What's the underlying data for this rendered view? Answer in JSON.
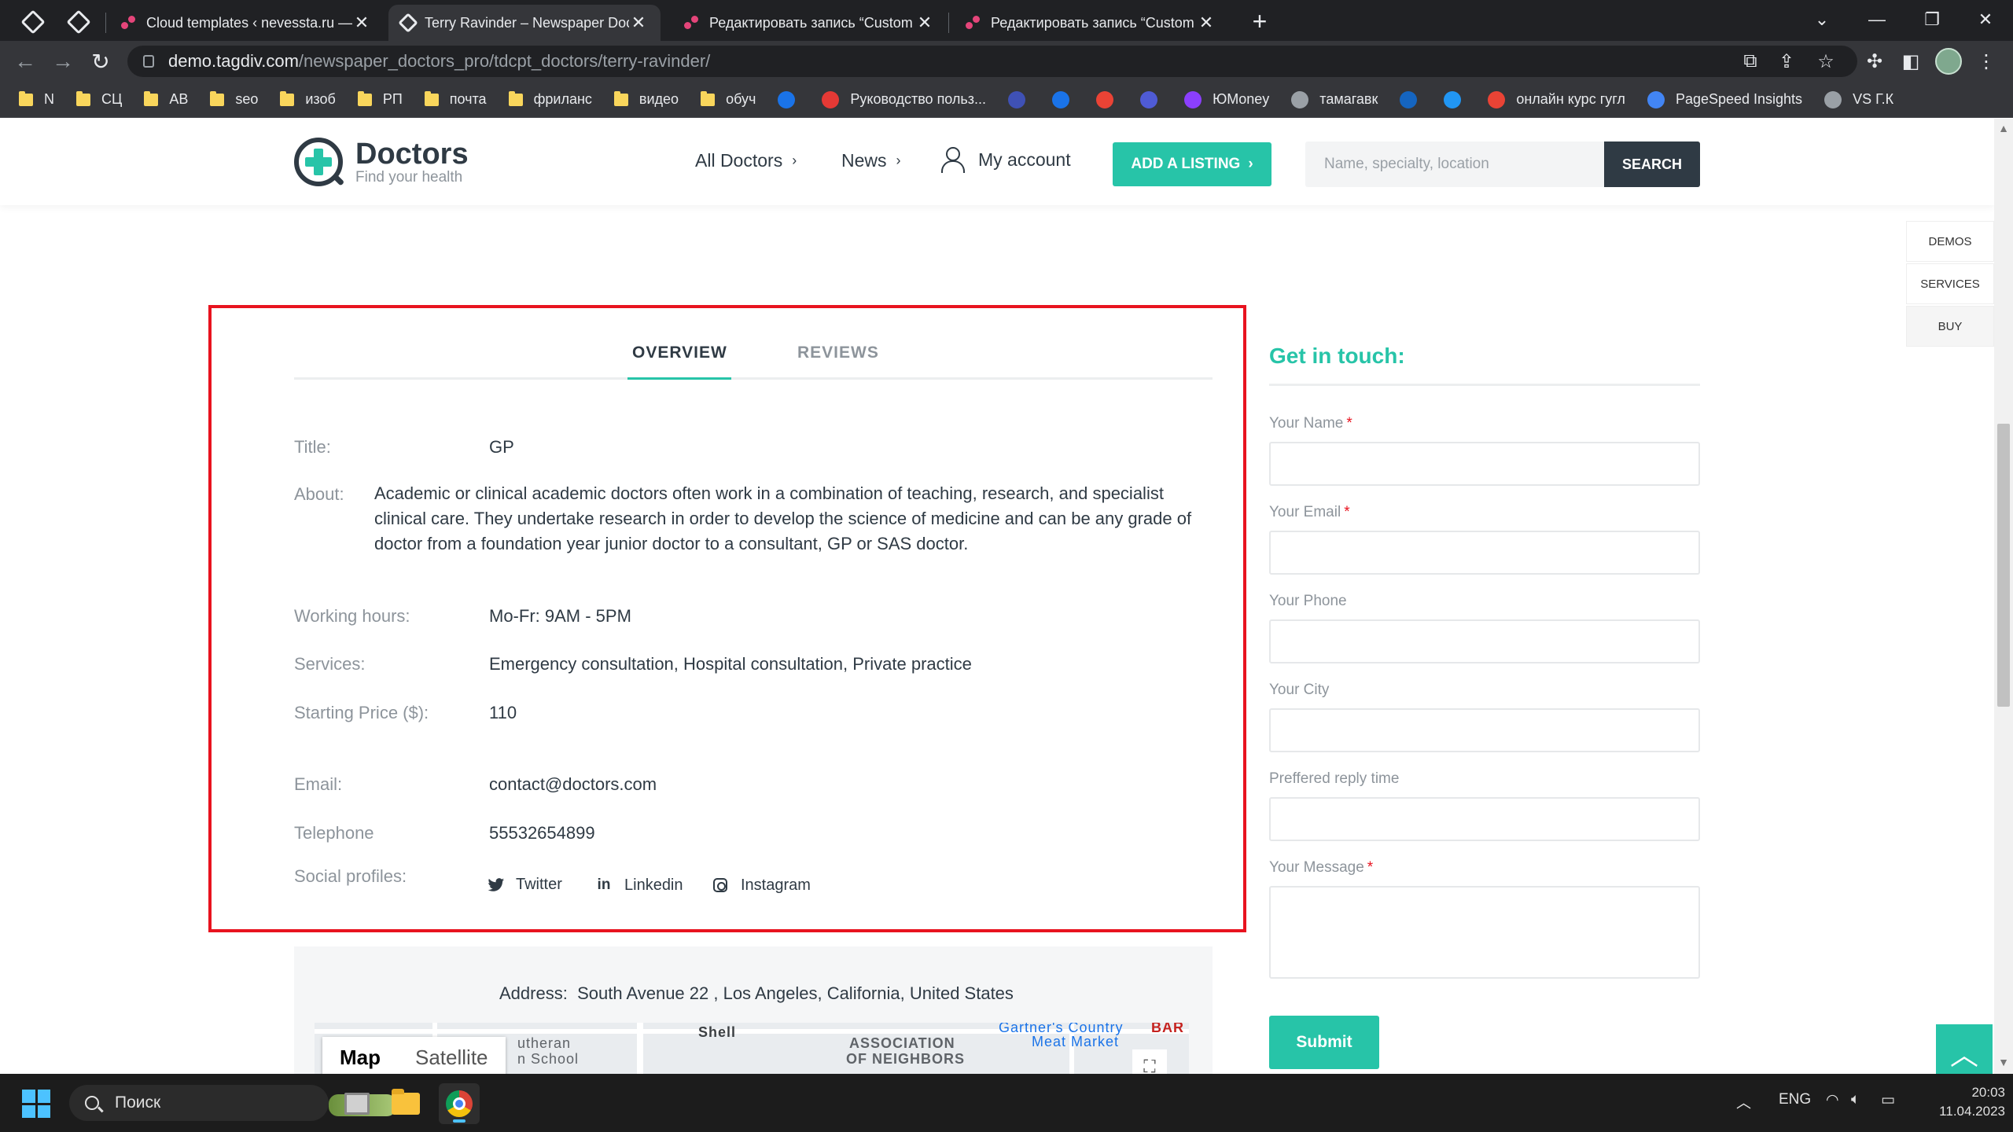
{
  "browser": {
    "tabs": [
      {
        "title": "Cloud templates ‹ nevessta.ru —",
        "active": false
      },
      {
        "title": "Terry Ravinder – Newspaper Doct",
        "active": true
      },
      {
        "title": "Редактировать запись “Custom",
        "active": false
      },
      {
        "title": "Редактировать запись “Custom",
        "active": false
      }
    ],
    "new_tab": "+",
    "tab_close": "✕",
    "url_host": "demo.tagdiv.com",
    "url_path": "/newspaper_doctors_pro/tdcpt_doctors/terry-ravinder/",
    "bookmarks": [
      {
        "label": "N",
        "type": "folder"
      },
      {
        "label": "СЦ",
        "type": "folder"
      },
      {
        "label": "АВ",
        "type": "folder"
      },
      {
        "label": "seo",
        "type": "folder"
      },
      {
        "label": "изоб",
        "type": "folder"
      },
      {
        "label": "РП",
        "type": "folder"
      },
      {
        "label": "почта",
        "type": "folder"
      },
      {
        "label": "фриланс",
        "type": "folder"
      },
      {
        "label": "видео",
        "type": "folder"
      },
      {
        "label": "обуч",
        "type": "folder"
      },
      {
        "label": "",
        "type": "site",
        "color": "#1a73e8"
      },
      {
        "label": "Руководство польз...",
        "type": "site",
        "color": "#e53935"
      },
      {
        "label": "",
        "type": "site",
        "color": "#3f51b5"
      },
      {
        "label": "",
        "type": "site",
        "color": "#1a73e8"
      },
      {
        "label": "",
        "type": "site",
        "color": "#ea4335"
      },
      {
        "label": "",
        "type": "site",
        "color": "#4f5bd5"
      },
      {
        "label": "ЮMoney",
        "type": "site",
        "color": "#8b3ffd"
      },
      {
        "label": "тамагавк",
        "type": "site",
        "color": "#9aa0a6"
      },
      {
        "label": "",
        "type": "site",
        "color": "#1565c0"
      },
      {
        "label": "",
        "type": "site",
        "color": "#2196f3"
      },
      {
        "label": "онлайн курс гугл",
        "type": "site",
        "color": "#ea4335"
      },
      {
        "label": "PageSpeed Insights",
        "type": "site",
        "color": "#4285f4"
      },
      {
        "label": "VS Г.К",
        "type": "site",
        "color": "#9aa0a6"
      }
    ]
  },
  "site": {
    "brand": "Doctors",
    "tagline": "Find your health",
    "nav": {
      "all_doctors": "All Doctors",
      "news": "News",
      "my_account": "My account"
    },
    "add_listing": "ADD A LISTING",
    "search_placeholder": "Name, specialty, location",
    "search_button": "SEARCH",
    "side_panel": [
      "DEMOS",
      "SERVICES",
      "BUY"
    ]
  },
  "profile": {
    "tabs": {
      "overview": "OVERVIEW",
      "reviews": "REVIEWS"
    },
    "fields": {
      "title_label": "Title:",
      "title_value": "GP",
      "about_label": "About:",
      "about_value": "Academic or clinical academic doctors often work in a combination of teaching, research, and specialist clinical care. They undertake research in order to develop the science of medicine and can be any grade of doctor from a foundation year junior doctor to a consultant, GP or SAS doctor.",
      "hours_label": "Working hours:",
      "hours_value": "Mo-Fr: 9AM - 5PM",
      "services_label": "Services:",
      "services_value": "Emergency consultation, Hospital consultation, Private practice",
      "price_label": "Starting Price ($):",
      "price_value": "110",
      "email_label": "Email:",
      "email_value": "contact@doctors.com",
      "phone_label": "Telephone",
      "phone_value": "55532654899",
      "social_label": "Social profiles:"
    },
    "social": {
      "twitter": "Twitter",
      "linkedin": "Linkedin",
      "instagram": "Instagram"
    },
    "address_label": "Address:",
    "address_value": "South Avenue 22 , Los Angeles, California, United States",
    "map": {
      "map_button": "Map",
      "satellite_button": "Satellite",
      "labels": [
        "Shell",
        "ASSOCIATION",
        "OF NEIGHBORS",
        "Gartner's Country",
        "Meat Market",
        "utheran",
        "n School",
        "BAR"
      ]
    }
  },
  "contact_form": {
    "title": "Get in touch:",
    "fields": [
      {
        "label": "Your Name",
        "required": "*"
      },
      {
        "label": "Your Email",
        "required": "*"
      },
      {
        "label": "Your Phone",
        "required": ""
      },
      {
        "label": "Your City",
        "required": ""
      },
      {
        "label": "Preffered reply time",
        "required": ""
      },
      {
        "label": "Your Message",
        "required": "*"
      }
    ],
    "submit": "Submit"
  },
  "taskbar": {
    "search_label": "Поиск",
    "language": "ENG",
    "time": "20:03",
    "date": "11.04.2023"
  },
  "colors": {
    "accent": "#27c4a8",
    "dark": "#2f3a44",
    "highlight_border": "#e8131f"
  }
}
